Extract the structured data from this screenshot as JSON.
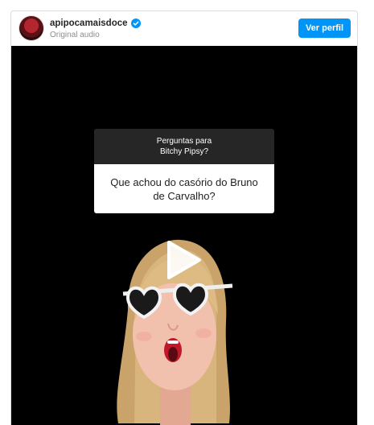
{
  "post": {
    "username": "apipocamaisdoce",
    "audio_label": "Original audio",
    "follow_button_label": "Ver perfil",
    "verified": true
  },
  "story_question": {
    "header_line1": "Perguntas para",
    "header_line2": "Bitchy Pipsy?",
    "question_text": "Que achou do casório do Bruno de Carvalho?"
  },
  "colors": {
    "accent": "#0095f6",
    "video_background": "#000000",
    "question_header_bg": "#262626"
  },
  "icons": {
    "verified": "verified-badge-icon",
    "play": "play-icon"
  }
}
